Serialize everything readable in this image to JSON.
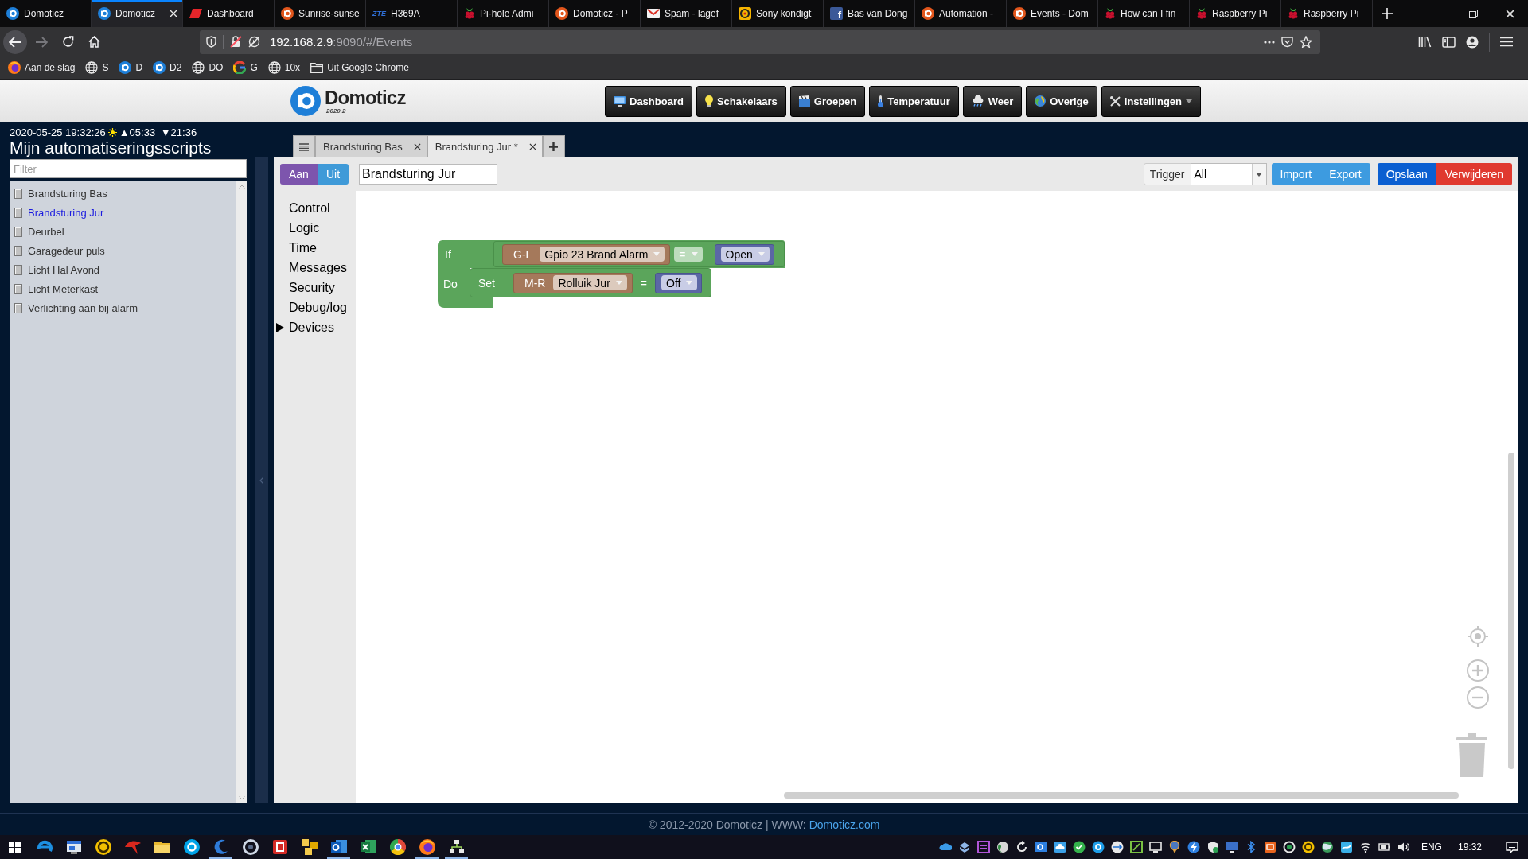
{
  "browser": {
    "tabs": [
      {
        "title": "Domoticz",
        "kind": "logo",
        "selected": false
      },
      {
        "title": "Domoticz",
        "kind": "logo",
        "selected": true
      },
      {
        "title": "Dashboard",
        "kind": "flag",
        "selected": false
      },
      {
        "title": "Sunrise-sunse",
        "kind": "orange",
        "selected": false
      },
      {
        "title": "H369A",
        "kind": "lettermark",
        "favicon_text": "ZTE",
        "selected": false
      },
      {
        "title": "Pi-hole Admi",
        "kind": "berry",
        "selected": false
      },
      {
        "title": "Domoticz - P",
        "kind": "orange",
        "selected": false
      },
      {
        "title": "Spam - lagef",
        "kind": "mail",
        "selected": false
      },
      {
        "title": "Sony kondigt",
        "kind": "badge",
        "selected": false
      },
      {
        "title": "Bas van Dong",
        "kind": "tile",
        "favicon_text": "f",
        "selected": false
      },
      {
        "title": "Automation -",
        "kind": "orange",
        "selected": false
      },
      {
        "title": "Events - Dom",
        "kind": "orange",
        "selected": false
      },
      {
        "title": "How can I fin",
        "kind": "berry",
        "selected": false
      },
      {
        "title": "Raspberry Pi",
        "kind": "berry",
        "selected": false
      },
      {
        "title": "Raspberry Pi",
        "kind": "berry",
        "selected": false
      }
    ],
    "address": {
      "host": "192.168.2.9",
      "path": ":9090/#/Events"
    },
    "bookmarks": [
      {
        "label": "Aan de slag",
        "kind": "orb"
      },
      {
        "label": "S",
        "kind": "globe"
      },
      {
        "label": "D",
        "kind": "logo"
      },
      {
        "label": "D2",
        "kind": "logo"
      },
      {
        "label": "DO",
        "kind": "globe"
      },
      {
        "label": "G",
        "kind": "ring"
      },
      {
        "label": "10x",
        "kind": "globe"
      },
      {
        "label": "Uit Google Chrome",
        "kind": "folder"
      }
    ]
  },
  "app_header": {
    "logo": {
      "name": "Domoticz",
      "version": "2020.2"
    },
    "nav": [
      {
        "label": "Dashboard",
        "kind": "monitor",
        "has_menu": false
      },
      {
        "label": "Schakelaars",
        "kind": "bulb",
        "has_menu": false
      },
      {
        "label": "Groepen",
        "kind": "clapper",
        "has_menu": false
      },
      {
        "label": "Temperatuur",
        "kind": "thermometer",
        "has_menu": false
      },
      {
        "label": "Weer",
        "kind": "cloud",
        "has_menu": false
      },
      {
        "label": "Overige",
        "kind": "globe",
        "has_menu": false
      },
      {
        "label": "Instellingen",
        "kind": "tools",
        "has_menu": true
      }
    ]
  },
  "sidebar": {
    "datetime": "2020-05-25 19:32:26",
    "sunrise": "▲05:33",
    "sunset": "▼21:36",
    "title": "Mijn automatiseringsscripts",
    "filter": {
      "placeholder": "Filter"
    },
    "scripts": [
      {
        "name": "Brandsturing Bas",
        "selected": false
      },
      {
        "name": "Brandsturing Jur",
        "selected": true
      },
      {
        "name": "Deurbel",
        "selected": false
      },
      {
        "name": "Garagedeur puls",
        "selected": false
      },
      {
        "name": "Licht Hal Avond",
        "selected": false
      },
      {
        "name": "Licht Meterkast",
        "selected": false
      },
      {
        "name": "Verlichting aan bij alarm",
        "selected": false
      }
    ]
  },
  "editor": {
    "tabs": [
      {
        "label": "Brandsturing Bas",
        "selected": false
      },
      {
        "label": "Brandsturing Jur *",
        "selected": true
      }
    ],
    "toolbar": {
      "toggle": [
        {
          "label": "Aan",
          "selected": true
        },
        {
          "label": "Uit",
          "selected": false
        }
      ],
      "name": "Brandsturing Jur",
      "trigger": {
        "label": "Trigger",
        "value": "All"
      },
      "buttons": [
        {
          "label": "Import",
          "kind": "info"
        },
        {
          "label": "Export",
          "kind": "info"
        },
        {
          "label": "Opslaan",
          "kind": "primary"
        },
        {
          "label": "Verwijderen",
          "kind": "danger"
        }
      ]
    },
    "toolbox": [
      {
        "label": "Control",
        "kind": "category"
      },
      {
        "label": "Logic",
        "kind": "category"
      },
      {
        "label": "Time",
        "kind": "category"
      },
      {
        "label": "Messages",
        "kind": "category"
      },
      {
        "label": "Security",
        "kind": "category"
      },
      {
        "label": "Debug/log",
        "kind": "category"
      },
      {
        "label": "Devices",
        "kind": "folder",
        "expanded": false
      }
    ],
    "workspace": {
      "blocks": [
        {
          "kind": "if",
          "if_label": "If",
          "do_label": "Do",
          "condition": {
            "kind": "compare",
            "operator": "=",
            "left": {
              "kind": "device",
              "prefix": "G-L",
              "value": "Gpio 23 Brand Alarm"
            },
            "right": {
              "kind": "state",
              "value": "Open"
            }
          },
          "statements": [
            {
              "kind": "set",
              "label": "Set",
              "operator": "=",
              "target": {
                "kind": "device",
                "prefix": "M-R",
                "value": "Rolluik Jur"
              },
              "value": {
                "kind": "state",
                "value": "Off"
              }
            }
          ]
        }
      ]
    }
  },
  "footer": {
    "text": "© 2012-2020 Domoticz | WWW:",
    "link": "Domoticz.com"
  },
  "taskbar": {
    "apps": [
      {
        "kind": "swirl",
        "running": false
      },
      {
        "kind": "window",
        "running": false
      },
      {
        "kind": "coin",
        "running": false
      },
      {
        "kind": "bird",
        "running": false
      },
      {
        "kind": "folder",
        "running": false
      },
      {
        "kind": "bubble",
        "running": false
      },
      {
        "kind": "crescent",
        "running": true
      },
      {
        "kind": "ring",
        "running": false
      },
      {
        "kind": "square",
        "running": false
      },
      {
        "kind": "grid",
        "running": false
      },
      {
        "kind": "mailtile",
        "running": true
      },
      {
        "kind": "sheet",
        "running": false
      },
      {
        "kind": "wheel",
        "running": false
      },
      {
        "kind": "orb",
        "running": true
      },
      {
        "kind": "network",
        "running": true
      }
    ],
    "language": "ENG",
    "time": "19:32"
  }
}
